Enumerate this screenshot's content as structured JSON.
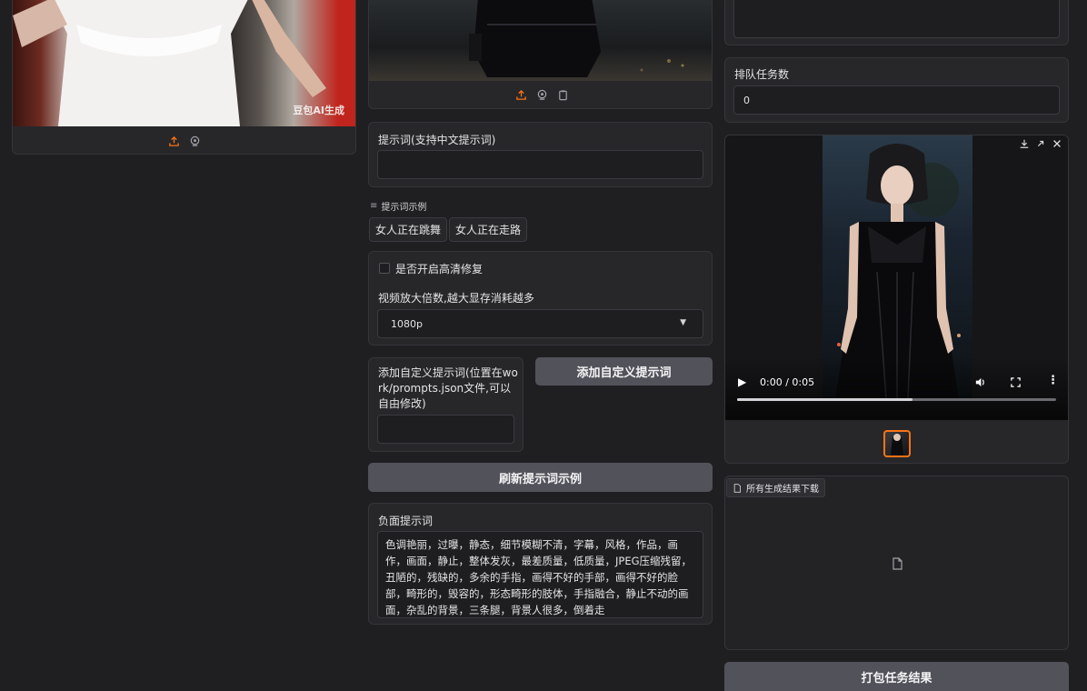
{
  "left_image": {
    "watermark": "豆包AI生成",
    "icons": [
      "upload-icon",
      "webcam-icon"
    ]
  },
  "middle": {
    "image_icons": [
      "upload-icon",
      "webcam-icon",
      "clipboard-icon"
    ],
    "prompt_label": "提示词(支持中文提示词)",
    "prompt_value": "",
    "examples_header": "提示词示例",
    "examples": [
      "女人正在跳舞",
      "女人正在走路"
    ],
    "hd_checkbox_label": "是否开启高清修复",
    "hd_checked": false,
    "scale_label": "视频放大倍数,越大显存消耗越多",
    "scale_value": "1080p",
    "custom_prompt_label": "添加自定义提示词(位置在work/prompts.json文件,可以自由修改)",
    "custom_prompt_value": "",
    "add_custom_button": "添加自定义提示词",
    "refresh_button": "刷新提示词示例",
    "negative_label": "负面提示词",
    "negative_value": "色调艳丽，过曝，静态，细节模糊不清，字幕，风格，作品，画作，画面，静止，整体发灰，最差质量，低质量，JPEG压缩残留，丑陋的，残缺的，多余的手指，画得不好的手部，画得不好的脸部，畸形的，毁容的，形态畸形的肢体，手指融合，静止不动的画面，杂乱的背景，三条腿，背景人很多，倒着走"
  },
  "right": {
    "queue_label": "排队任务数",
    "queue_value": "0",
    "video_time": "0:00 / 0:05",
    "video_progress": 0.55,
    "download_tag": "所有生成结果下载",
    "pack_button": "打包任务结果"
  },
  "colors": {
    "accent": "#f97316",
    "bg": "#1f1f22",
    "panel": "#27272a",
    "button": "#52525b"
  }
}
